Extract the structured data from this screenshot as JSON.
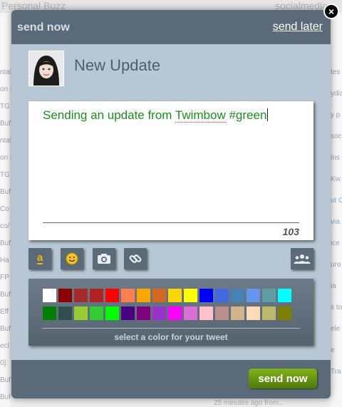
{
  "background": {
    "left_title": "Personal Buzz",
    "right_title": "socialmedia",
    "left_fragments": [
      "ntal",
      "on F",
      "TG",
      "Buff",
      "ntal",
      "on F",
      "TG",
      "Buf",
      "Co",
      "co/",
      "Buf",
      "Ha",
      "FP",
      "Buf",
      "Eff",
      "Buf",
      "ecl",
      "0]:",
      "Buf",
      "Buf"
    ],
    "right_fragments": [
      "tes",
      "ydia",
      "y p",
      "soc",
      "ins",
      "Kw",
      "ut C",
      "via",
      "ice",
      "uro",
      "ia",
      "s to",
      "ele",
      "e",
      "Tra"
    ],
    "bottom_text": "25 minutes ago from..."
  },
  "modal": {
    "header": {
      "send_now": "send now",
      "send_later": "send later"
    },
    "title": "New Update",
    "compose": {
      "text_before": "Sending an update from ",
      "text_misspelled": "Twimbow",
      "text_after": " #green",
      "char_count": "103"
    },
    "toolbar": {
      "amazon": "a",
      "emoji_icon": "smiley-icon",
      "photo_icon": "camera-icon",
      "link_icon": "link-icon",
      "group_icon": "group-icon"
    },
    "palette": {
      "hint": "select a color for your tweet",
      "row1": [
        "#ffffff",
        "#8b0000",
        "#a52a2a",
        "#b22222",
        "#ff0000",
        "#ff7f50",
        "#ffa500",
        "#d2691e",
        "#ffd700",
        "#ffff00",
        "#0000ff",
        "#4169e1",
        "#4682b4",
        "#6495ed",
        "#5f9ea0",
        "#00ffff"
      ],
      "row2": [
        "#008000",
        "#2f4f4f",
        "#9acd32",
        "#32cd32",
        "#00ff00",
        "#4b0082",
        "#800080",
        "#9932cc",
        "#ff00ff",
        "#da70d6",
        "#ffc0cb",
        "#bc8f8f",
        "#d2b48c",
        "#ffdab9",
        "#bdb76b",
        "#808000"
      ]
    },
    "footer": {
      "send_now_button": "send now"
    },
    "close_label": "×"
  },
  "colors": {
    "accent_green": "#1a8f1a",
    "header": "#5a6a79",
    "panel": "#b8c7d5"
  }
}
